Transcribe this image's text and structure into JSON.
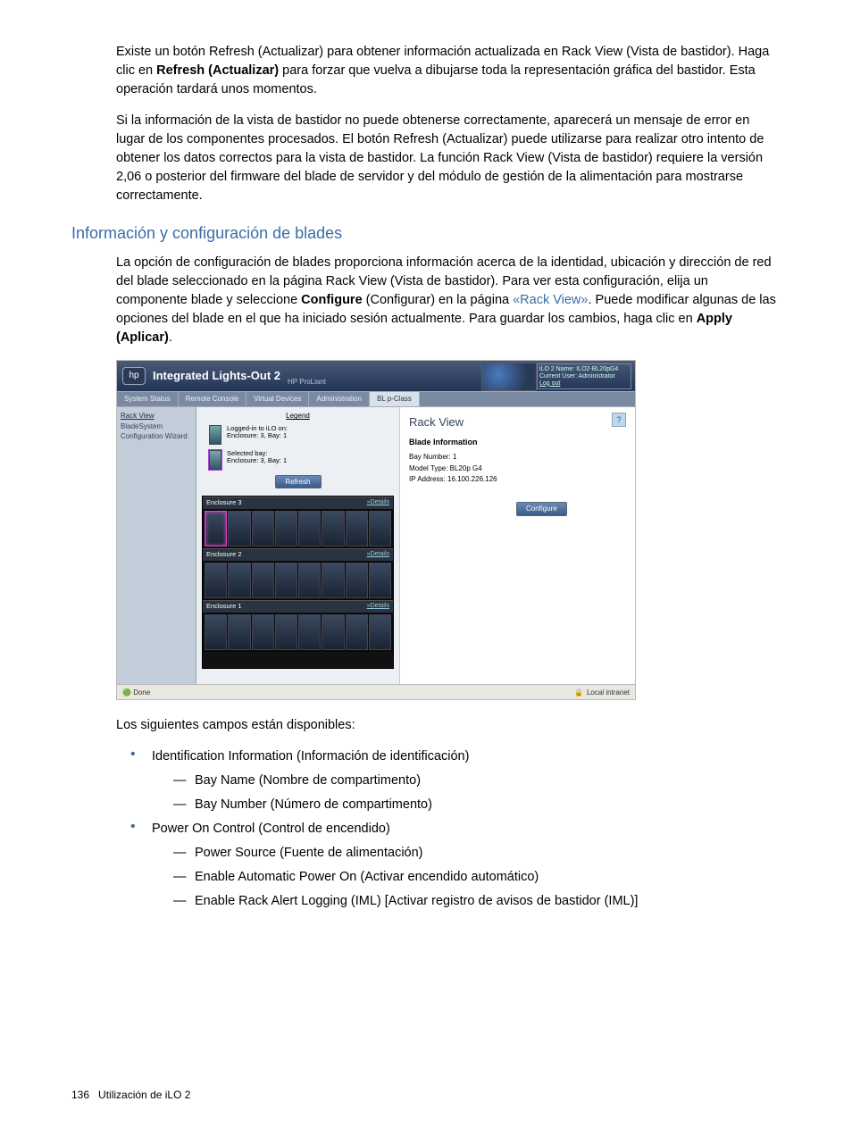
{
  "p1_a": "Existe un botón Refresh (Actualizar) para obtener información actualizada en Rack View (Vista de bastidor). Haga clic en ",
  "p1_b": "Refresh (Actualizar)",
  "p1_c": " para forzar que vuelva a dibujarse toda la representación gráfica del bastidor. Esta operación tardará unos momentos.",
  "p2": "Si la información de la vista de bastidor no puede obtenerse correctamente, aparecerá un mensaje de error en lugar de los componentes procesados. El botón Refresh (Actualizar) puede utilizarse para realizar otro intento de obtener los datos correctos para la vista de bastidor. La función Rack View (Vista de bastidor) requiere la versión 2,06 o posterior del firmware del blade de servidor y del módulo de gestión de la alimentación para mostrarse correctamente.",
  "h2": "Información y configuración de blades",
  "p3_a": "La opción de configuración de blades proporciona información acerca de la identidad, ubicación y dirección de red del blade seleccionado en la página Rack View (Vista de bastidor). Para ver esta configuración, elija un componente blade y seleccione ",
  "p3_b": "Configure",
  "p3_c": " (Configurar) en la página ",
  "p3_link": "«Rack View»",
  "p3_d": ". Puede modificar algunas de las opciones del blade en el que ha iniciado sesión actualmente. Para guardar los cambios, haga clic en ",
  "p3_e": "Apply (Aplicar)",
  "p3_f": ".",
  "screenshot": {
    "title": "Integrated Lights-Out 2",
    "subtitle": "HP ProLiant",
    "user_line1": "iLO 2 Name: ILO2-BL20pG4",
    "user_line2": "Current User: Administrator",
    "user_logout": "Log out",
    "tabs": [
      "System Status",
      "Remote Console",
      "Virtual Devices",
      "Administration",
      "BL p-Class"
    ],
    "nav": {
      "rack_view": "Rack View",
      "wizard": "BladeSystem Configuration Wizard"
    },
    "legend": {
      "heading": "Legend",
      "logged_l1": "Logged-in to iLO on:",
      "logged_l2": "Enclosure: 3, Bay: 1",
      "sel_l1": "Selected bay:",
      "sel_l2": "Enclosure: 3, Bay: 1",
      "refresh": "Refresh"
    },
    "enclosures": [
      {
        "name": "Enclosure 3",
        "details": "»Details"
      },
      {
        "name": "Enclosure 2",
        "details": "»Details"
      },
      {
        "name": "Enclosure 1",
        "details": "»Details"
      }
    ],
    "main": {
      "heading": "Rack View",
      "help": "?",
      "blade_info_h": "Blade Information",
      "bay": "Bay Number: 1",
      "model": "Model Type: BL20p G4",
      "ip": "IP Address: 16.100.226.126",
      "configure": "Configure"
    },
    "status_done": "Done",
    "status_zone": "Local intranet"
  },
  "after_ss": "Los siguientes campos están disponibles:",
  "list": {
    "a": "Identification Information (Información de identificación)",
    "a1": "Bay Name (Nombre de compartimento)",
    "a2": "Bay Number (Número de compartimento)",
    "b": "Power On Control (Control de encendido)",
    "b1": "Power Source (Fuente de alimentación)",
    "b2": "Enable Automatic Power On (Activar encendido automático)",
    "b3": "Enable Rack Alert Logging (IML) [Activar registro de avisos de bastidor (IML)]"
  },
  "footer_page": "136",
  "footer_title": "Utilización de iLO 2"
}
